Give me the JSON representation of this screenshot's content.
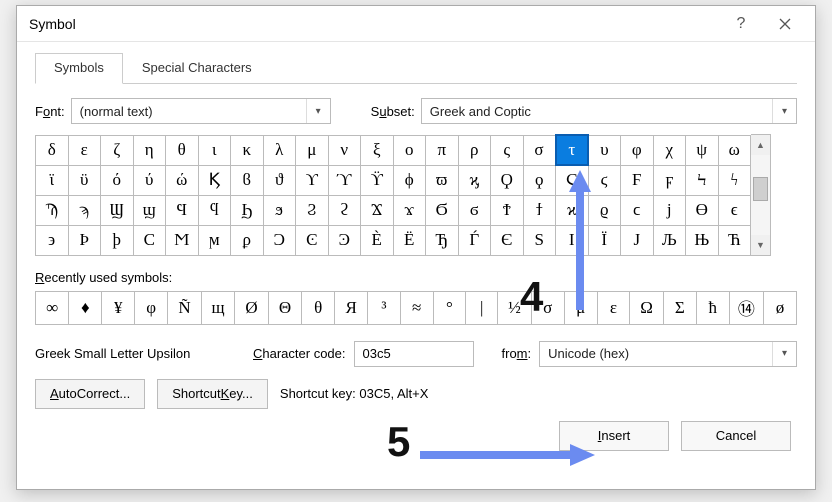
{
  "dialog": {
    "title": "Symbol",
    "help_label": "?",
    "tabs": [
      "Symbols",
      "Special Characters"
    ],
    "active_tab": 0
  },
  "filters": {
    "font_label_pre": "F",
    "font_label_und": "o",
    "font_label_post": "nt:",
    "font_value": "(normal text)",
    "subset_label_pre": "S",
    "subset_label_und": "u",
    "subset_label_post": "bset:",
    "subset_value": "Greek and Coptic"
  },
  "grid": {
    "cols": 22,
    "rows": 4,
    "selected": {
      "row": 0,
      "col": 16
    },
    "cells": [
      [
        "δ",
        "ε",
        "ζ",
        "η",
        "θ",
        "ι",
        "κ",
        "λ",
        "μ",
        "ν",
        "ξ",
        "ο",
        "π",
        "ρ",
        "ς",
        "σ",
        "τ",
        "υ",
        "φ",
        "χ",
        "ψ",
        "ω"
      ],
      [
        "ϊ",
        "ϋ",
        "ό",
        "ύ",
        "ώ",
        "Ϗ",
        "ϐ",
        "ϑ",
        "ϒ",
        "ϓ",
        "ϔ",
        "ϕ",
        "ϖ",
        "ϗ",
        "Ϙ",
        "ϙ",
        "Ϛ",
        "ϛ",
        "Ϝ",
        "ϝ",
        "Ϟ",
        "ϟ"
      ],
      [
        "Ϡ",
        "ϡ",
        "Ϣ",
        "ϣ",
        "Ϥ",
        "ϥ",
        "Ϧ",
        "ϧ",
        "Ϩ",
        "ϩ",
        "Ϫ",
        "ϫ",
        "Ϭ",
        "ϭ",
        "Ϯ",
        "ϯ",
        "ϰ",
        "ϱ",
        "ϲ",
        "ϳ",
        "ϴ",
        "ϵ"
      ],
      [
        "϶",
        "Ϸ",
        "ϸ",
        "Ϲ",
        "Ϻ",
        "ϻ",
        "ϼ",
        "Ͻ",
        "Ͼ",
        "Ͽ",
        "Ѐ",
        "Ё",
        "Ђ",
        "Ѓ",
        "Є",
        "Ѕ",
        "І",
        "Ї",
        "Ј",
        "Љ",
        "Њ",
        "Ћ"
      ]
    ]
  },
  "recent": {
    "label_und": "R",
    "label_post": "ecently used symbols:",
    "cells": [
      "∞",
      "♦",
      "¥",
      "φ",
      "Ñ",
      "щ",
      "Ø",
      "Θ",
      "θ",
      "Я",
      "³",
      "≈",
      "°",
      "|",
      "½",
      "σ",
      "μ",
      "ε",
      "Ω",
      "Σ",
      "ħ",
      "⑭",
      "ø"
    ]
  },
  "meta": {
    "unicode_name": "Greek Small Letter Upsilon",
    "charcode_label_und": "C",
    "charcode_label_post": "haracter code:",
    "charcode_value": "03c5",
    "from_label_pre": "fro",
    "from_label_und": "m",
    "from_label_post": ":",
    "from_value": "Unicode (hex)"
  },
  "buttons": {
    "autocorrect_und": "A",
    "autocorrect_post": "utoCorrect...",
    "shortcut_pre": "Shortcut ",
    "shortcut_und": "K",
    "shortcut_post": "ey...",
    "shortcut_info": "Shortcut key: 03C5, Alt+X",
    "insert_und": "I",
    "insert_post": "nsert",
    "cancel": "Cancel"
  },
  "annotations": {
    "num4": "4",
    "num5": "5"
  },
  "colors": {
    "selection": "#0a7de0",
    "annotation_arrow": "#6b8bf0"
  }
}
